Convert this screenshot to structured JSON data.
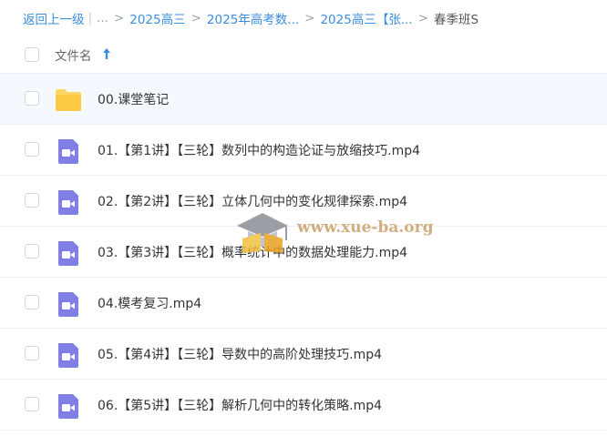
{
  "breadcrumb": {
    "back": "返回上一级",
    "ellipsis": "...",
    "items": [
      "2025高三",
      "2025年高考数...",
      "2025高三【张..."
    ],
    "current": "春季班S"
  },
  "header": {
    "name_label": "文件名",
    "sort_icon": "arrow-up-icon"
  },
  "files": [
    {
      "name": "00.课堂笔记",
      "type": "folder"
    },
    {
      "name": "01.【第1讲】【三轮】数列中的构造论证与放缩技巧.mp4",
      "type": "video"
    },
    {
      "name": "02.【第2讲】【三轮】立体几何中的变化规律探索.mp4",
      "type": "video"
    },
    {
      "name": "03.【第3讲】【三轮】概率统计中的数据处理能力.mp4",
      "type": "video"
    },
    {
      "name": "04.模考复习.mp4",
      "type": "video"
    },
    {
      "name": "05.【第4讲】【三轮】导数中的高阶处理技巧.mp4",
      "type": "video"
    },
    {
      "name": "06.【第5讲】【三轮】解析几何中的转化策略.mp4",
      "type": "video"
    }
  ],
  "watermark": {
    "text": "www.xue-ba.org"
  },
  "colors": {
    "link": "#3b8cde",
    "folder": "#ffd666",
    "video": "#7f7fe6",
    "selected_row": "#f3f9fe"
  }
}
